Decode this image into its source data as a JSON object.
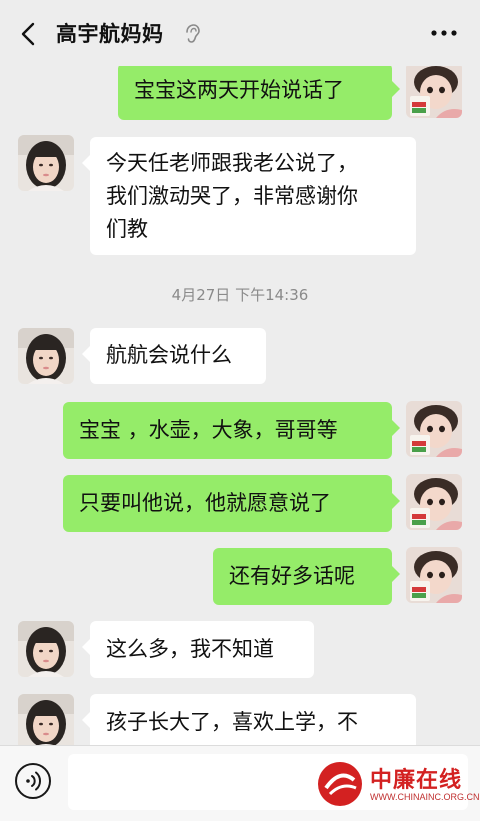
{
  "header": {
    "title": "高宇航妈妈",
    "back_icon": "back-arrow",
    "ear_icon": "ear-mode",
    "more_icon": "more-dots"
  },
  "messages": {
    "m1": "宝宝这两天开始说话了",
    "m2": "今天任老师跟我老公说了，\n我们激动哭了，非常感谢你\n们教",
    "ts1": "4月27日 下午14:36",
    "m3": "航航会说什么",
    "m4": "宝宝 ，水壶，大象，哥哥等",
    "m5": "只要叫他说，他就愿意说了",
    "m6": "还有好多话呢",
    "m7": "这么多，我不知道",
    "m8": "孩子长大了，喜欢上学，不"
  },
  "input_bar": {
    "voice_icon": "voice-mode",
    "input_value": ""
  },
  "watermark": {
    "text": "中廉在线",
    "url": "WWW.CHINAINC.ORG.CN"
  },
  "colors": {
    "background": "#ededed",
    "bubble_self": "#95ec69",
    "bubble_other": "#ffffff",
    "watermark": "#d32121"
  }
}
